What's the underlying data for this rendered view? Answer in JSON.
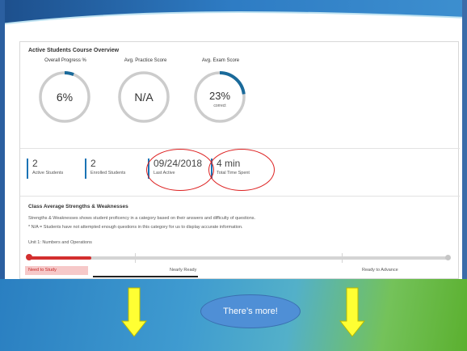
{
  "overview": {
    "title": "Active Students Course Overview",
    "gauges": [
      {
        "label": "Overall Progress %",
        "value": "6%",
        "sub": "",
        "progress": 0.06
      },
      {
        "label": "Avg. Practice Score",
        "value": "N/A",
        "sub": "",
        "progress": 0
      },
      {
        "label": "Avg. Exam Score",
        "value": "23%",
        "sub": "correct",
        "progress": 0.23
      }
    ],
    "stats": [
      {
        "number": "2",
        "label": "Active Students"
      },
      {
        "number": "2",
        "label": "Enrolled Students"
      },
      {
        "number": "09/24/2018",
        "label": "Last Active"
      },
      {
        "number": "4 min",
        "label": "Total Time Spent"
      }
    ]
  },
  "strengths": {
    "title": "Class Average Strengths & Weaknesses",
    "desc1": "Strengths & Weaknesses shows student proficency in a category based on their answers and difficulty of questions.",
    "desc2": "* N/A = Students have not attempted enough questions in this category for us to display accurate information.",
    "unit": "Unit 1: Numbers and Operations",
    "progress": 0.15,
    "levels": {
      "need": "Need to Study",
      "nearly": "Nearly Ready",
      "ready": "Ready to Advance"
    }
  },
  "callout": {
    "text": "There’s more!"
  },
  "colors": {
    "accent": "#1a73b5",
    "gauge_track": "#cccccc",
    "annotation": "#dd2222",
    "arrow": "#ffff33",
    "bubble": "#4f8fd6"
  }
}
